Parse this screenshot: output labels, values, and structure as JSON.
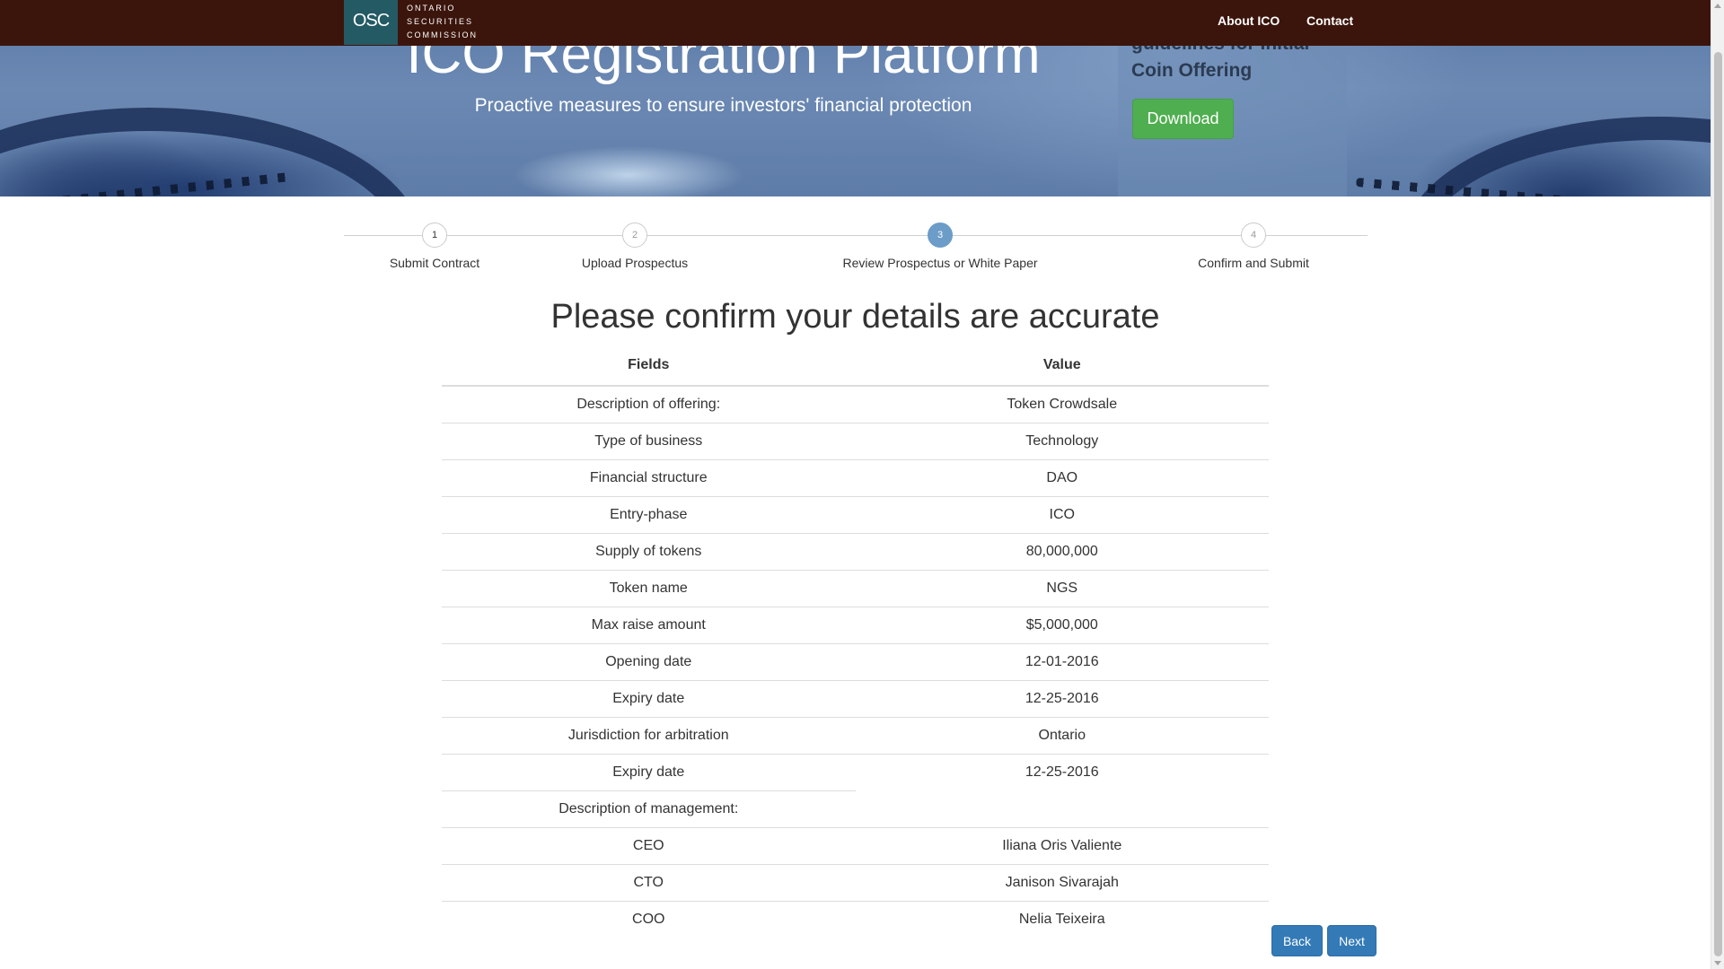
{
  "navbar": {
    "logo_mark": "OSC",
    "logo_lines": [
      "ONTARIO",
      "SECURITIES",
      "COMMISSION"
    ],
    "links": [
      "About ICO",
      "Contact"
    ],
    "background": "#3b150c"
  },
  "hero": {
    "title": "ICO Registration Platform",
    "subtitle": "Proactive measures to ensure investors' financial protection",
    "panel_text": "guidelines for Initial Coin Offering",
    "download_label": "Download",
    "download_color": "#4fae4f"
  },
  "stepper": {
    "active_step": 3,
    "active_color": "#6c9cc8",
    "steps": [
      {
        "number": "1",
        "label": "Submit Contract",
        "state": "completed"
      },
      {
        "number": "2",
        "label": "Upload Prospectus",
        "state": "pending"
      },
      {
        "number": "3",
        "label": "Review Prospectus or White Paper",
        "state": "active"
      },
      {
        "number": "4",
        "label": "Confirm and Submit",
        "state": "pending"
      }
    ]
  },
  "confirmation": {
    "title": "Please confirm your details are accurate",
    "columns": [
      "Fields",
      "Value"
    ],
    "rows": [
      {
        "field": "Description of offering:",
        "value": "Token Crowdsale"
      },
      {
        "field": "Type of business",
        "value": "Technology"
      },
      {
        "field": "Financial structure",
        "value": "DAO"
      },
      {
        "field": "Entry-phase",
        "value": "ICO"
      },
      {
        "field": "Supply of tokens",
        "value": "80,000,000"
      },
      {
        "field": "Token name",
        "value": "NGS"
      },
      {
        "field": "Max raise amount",
        "value": "$5,000,000"
      },
      {
        "field": "Opening date",
        "value": "12-01-2016"
      },
      {
        "field": "Expiry date",
        "value": "12-25-2016"
      },
      {
        "field": "Jurisdiction for arbitration",
        "value": "Ontario"
      },
      {
        "field": "Expiry date",
        "value": "12-25-2016"
      },
      {
        "field": "Description of management:",
        "value": ""
      },
      {
        "field": "CEO",
        "value": "Iliana Oris Valiente"
      },
      {
        "field": "CTO",
        "value": "Janison Sivarajah"
      },
      {
        "field": "COO",
        "value": "Nelia Teixeira"
      }
    ]
  },
  "actions": {
    "back_label": "Back",
    "next_label": "Next",
    "button_color": "#337ab7"
  }
}
